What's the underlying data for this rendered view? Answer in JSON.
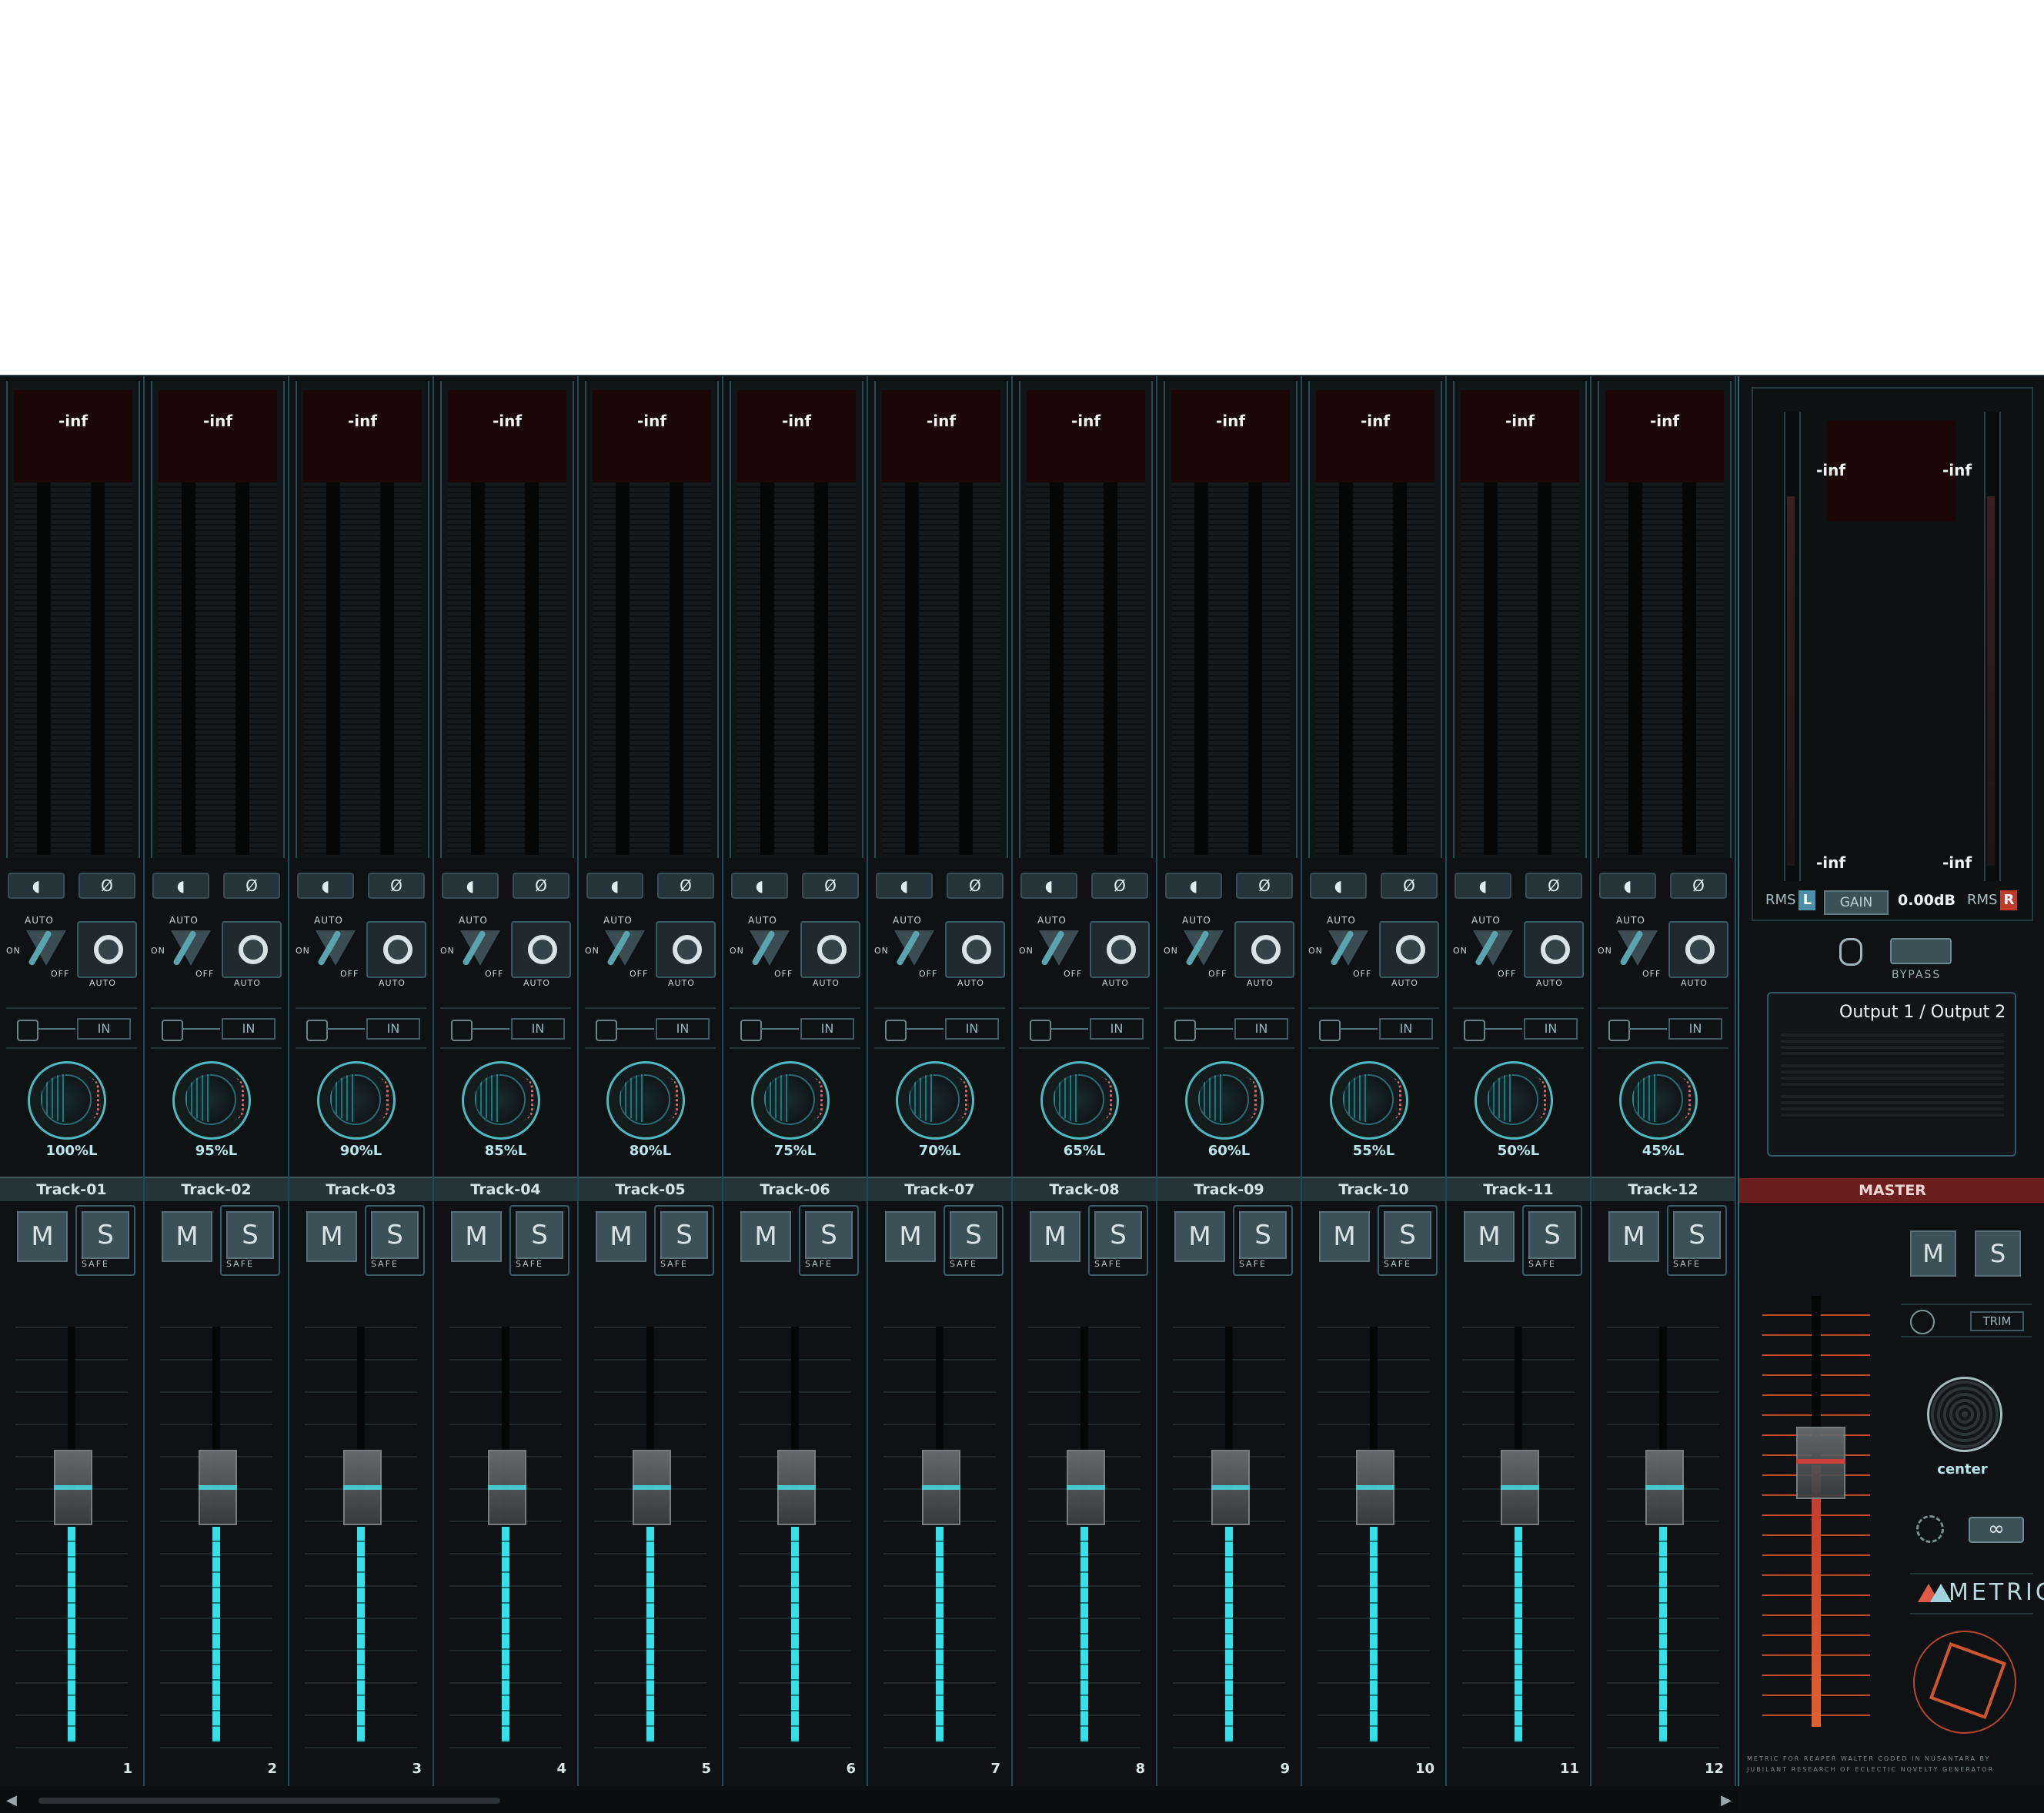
{
  "tracks": [
    {
      "name": "Track-01",
      "peak": "-inf",
      "pan": "100%L",
      "num": "1"
    },
    {
      "name": "Track-02",
      "peak": "-inf",
      "pan": "95%L",
      "num": "2"
    },
    {
      "name": "Track-03",
      "peak": "-inf",
      "pan": "90%L",
      "num": "3"
    },
    {
      "name": "Track-04",
      "peak": "-inf",
      "pan": "85%L",
      "num": "4"
    },
    {
      "name": "Track-05",
      "peak": "-inf",
      "pan": "80%L",
      "num": "5"
    },
    {
      "name": "Track-06",
      "peak": "-inf",
      "pan": "75%L",
      "num": "6"
    },
    {
      "name": "Track-07",
      "peak": "-inf",
      "pan": "70%L",
      "num": "7"
    },
    {
      "name": "Track-08",
      "peak": "-inf",
      "pan": "65%L",
      "num": "8"
    },
    {
      "name": "Track-09",
      "peak": "-inf",
      "pan": "60%L",
      "num": "9"
    },
    {
      "name": "Track-10",
      "peak": "-inf",
      "pan": "55%L",
      "num": "10"
    },
    {
      "name": "Track-11",
      "peak": "-inf",
      "pan": "50%L",
      "num": "11"
    },
    {
      "name": "Track-12",
      "peak": "-inf",
      "pan": "45%L",
      "num": "12"
    }
  ],
  "strip_labels": {
    "auto_top": "AUTO",
    "on": "ON",
    "off": "OFF",
    "auto_btn": "AUTO",
    "fx_in": "IN",
    "mute": "M",
    "solo": "S",
    "safe": "SAFE",
    "phase_symbol": "Ø"
  },
  "master": {
    "name": "MASTER",
    "peak_l_top": "-inf",
    "peak_r_top": "-inf",
    "peak_l_bottom": "-inf",
    "peak_r_bottom": "-inf",
    "rms_left": "RMS",
    "rms_left_ch": "L",
    "rms_right": "RMS",
    "rms_right_ch": "R",
    "gain_btn": "GAIN",
    "gain_value": "0.00dB",
    "bypass": "BYPASS",
    "output": "Output 1 / Output 2",
    "mute": "M",
    "solo": "S",
    "trim": "TRIM",
    "pan": "center",
    "link_symbol": "∞",
    "logo": "METRIC",
    "credit_line1": "METRIC FOR REAPER WALTER CODED IN NUSANTARA BY",
    "credit_line2": "JUBILANT RESEARCH OF ECLECTIC NOVELTY GENERATOR"
  },
  "colors": {
    "accent": "#36e0e8",
    "master_accent": "#e06030",
    "master_name_bg": "#6b1e1e"
  }
}
